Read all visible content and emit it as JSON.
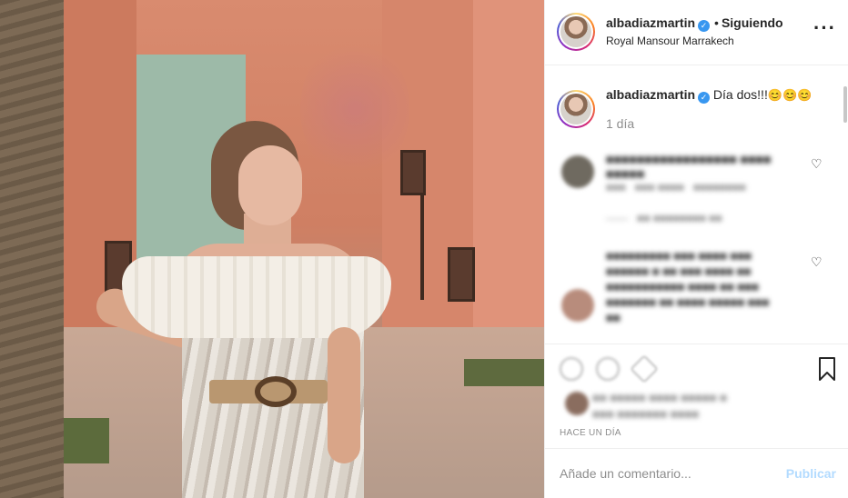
{
  "header": {
    "username": "albadiazmartin",
    "dot": "•",
    "follow_status": "Siguiendo",
    "location": "Royal Mansour Marrakech",
    "more_icon": "more-horizontal-icon"
  },
  "caption": {
    "username": "albadiazmartin",
    "text": "Día dos!!!",
    "emojis": "😊😊😊",
    "time": "1 día"
  },
  "comments": [
    {
      "username": "(blurred)",
      "text": "(blurred)",
      "meta": "(blurred)",
      "replies": "(blurred)"
    },
    {
      "username": "(blurred)",
      "text": "(blurred)"
    }
  ],
  "actions": {
    "likes_text": "(blurred)",
    "time_ago": "HACE UN DÍA"
  },
  "add_comment": {
    "placeholder": "Añade un comentario...",
    "publish_label": "Publicar"
  },
  "colors": {
    "verified": "#3897f0",
    "publish_disabled": "#b3dbff",
    "secondary_text": "#8e8e8e"
  }
}
